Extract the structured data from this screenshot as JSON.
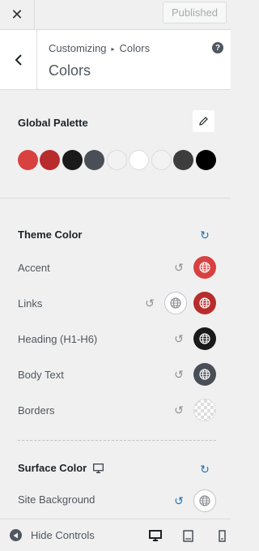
{
  "topbar": {
    "close_glyph": "✕",
    "publish_label": "Published"
  },
  "header": {
    "breadcrumb_parent": "Customizing",
    "breadcrumb_separator": "▸",
    "breadcrumb_current": "Colors",
    "title": "Colors",
    "help_glyph": "?"
  },
  "global_palette": {
    "title": "Global Palette",
    "swatches": [
      "#d94141",
      "#b82c2c",
      "#1a1a1a",
      "#4a4f57",
      "#f2f2f2",
      "#ffffff",
      "#f2f2f2",
      "#3d3d3d",
      "#000000"
    ]
  },
  "theme_color": {
    "title": "Theme Color",
    "rows": [
      {
        "label": "Accent",
        "color": "#d94141"
      },
      {
        "label": "Links",
        "color": "#b82c2c",
        "hover_color": "#ffffff"
      },
      {
        "label": "Heading (H1-H6)",
        "color": "#1a1a1a"
      },
      {
        "label": "Body Text",
        "color": "#4a4f57"
      },
      {
        "label": "Borders",
        "color": "transparent"
      }
    ]
  },
  "surface_color": {
    "title": "Surface Color",
    "rows": [
      {
        "label": "Site Background",
        "color": "#ffffff"
      }
    ]
  },
  "footer": {
    "hide_controls_label": "Hide Controls"
  },
  "colors": {
    "reset_active": "#2271b1",
    "reset_idle": "#8c8f94"
  }
}
